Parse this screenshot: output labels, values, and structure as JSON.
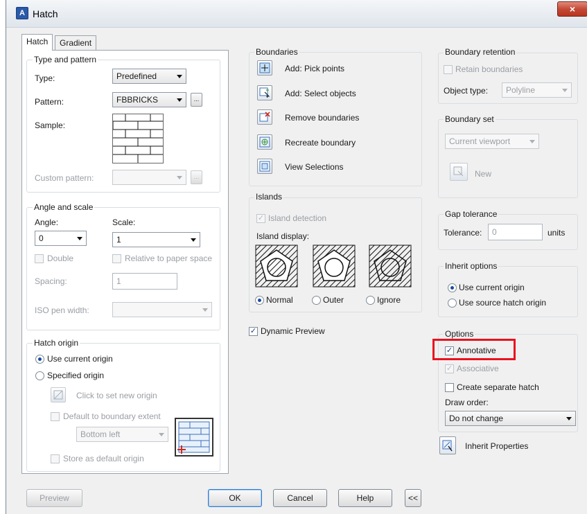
{
  "window": {
    "title": "Hatch",
    "close_glyph": "×",
    "app_icon": "autocad-icon"
  },
  "tabs": [
    {
      "label": "Hatch"
    },
    {
      "label": "Gradient"
    }
  ],
  "type_and_pattern": {
    "title": "Type and pattern",
    "type_label": "Type:",
    "type_value": "Predefined",
    "pattern_label": "Pattern:",
    "pattern_value": "FBBRICKS",
    "ellipsis": "...",
    "sample_label": "Sample:",
    "custom_pattern_label": "Custom pattern:"
  },
  "angle_and_scale": {
    "title": "Angle and scale",
    "angle_label": "Angle:",
    "angle_value": "0",
    "scale_label": "Scale:",
    "scale_value": "1",
    "double_label": "Double",
    "relative_label": "Relative to paper space",
    "spacing_label": "Spacing:",
    "spacing_value": "1",
    "iso_label": "ISO pen width:"
  },
  "hatch_origin": {
    "title": "Hatch origin",
    "use_current_label": "Use current origin",
    "specified_label": "Specified origin",
    "click_new_label": "Click to set new origin",
    "default_extent_label": "Default to boundary extent",
    "position_value": "Bottom left",
    "store_default_label": "Store as default origin"
  },
  "boundaries": {
    "title": "Boundaries",
    "items": [
      {
        "label": "Add: Pick points"
      },
      {
        "label": "Add: Select objects"
      },
      {
        "label": "Remove boundaries"
      },
      {
        "label": "Recreate boundary"
      },
      {
        "label": "View Selections"
      }
    ]
  },
  "islands": {
    "title": "Islands",
    "detection_label": "Island detection",
    "display_label": "Island display:",
    "normal_label": "Normal",
    "outer_label": "Outer",
    "ignore_label": "Ignore"
  },
  "dynamic_preview_label": "Dynamic Preview",
  "boundary_retention": {
    "title": "Boundary retention",
    "retain_label": "Retain boundaries",
    "object_type_label": "Object type:",
    "object_type_value": "Polyline"
  },
  "boundary_set": {
    "title": "Boundary set",
    "value": "Current viewport",
    "new_label": "New"
  },
  "gap_tolerance": {
    "title": "Gap tolerance",
    "tolerance_label": "Tolerance:",
    "tolerance_value": "0",
    "units_label": "units"
  },
  "inherit_options": {
    "title": "Inherit options",
    "use_current_label": "Use current origin",
    "use_source_label": "Use source hatch origin"
  },
  "options": {
    "title": "Options",
    "annotative_label": "Annotative",
    "associative_label": "Associative",
    "separate_label": "Create separate hatch",
    "draw_order_label": "Draw order:",
    "draw_order_value": "Do not change"
  },
  "inherit_properties_label": "Inherit Properties",
  "footer": {
    "preview": "Preview",
    "ok": "OK",
    "cancel": "Cancel",
    "help": "Help",
    "collapse": "<<"
  },
  "colors": {
    "highlight": "#e8121f",
    "accent": "#1b4aa3"
  }
}
